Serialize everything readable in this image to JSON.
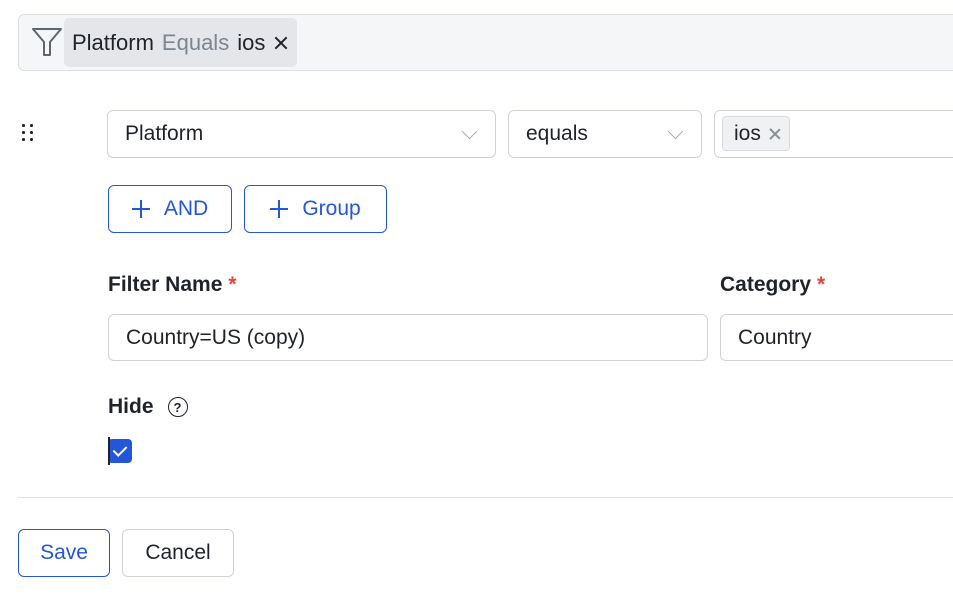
{
  "summary": {
    "field": "Platform",
    "operator": "Equals",
    "value": "ios",
    "icon": "funnel-icon"
  },
  "condition": {
    "field_select": "Platform",
    "operator_select": "equals",
    "value_tag": "ios"
  },
  "actions": {
    "and_label": "AND",
    "group_label": "Group"
  },
  "form": {
    "filter_name_label": "Filter Name",
    "filter_name_value": "Country=US (copy)",
    "category_label": "Category",
    "category_value": "Country",
    "required_mark": "*",
    "hide_label": "Hide",
    "help_glyph": "?",
    "hide_checked": true
  },
  "footer": {
    "save_label": "Save",
    "cancel_label": "Cancel"
  },
  "colors": {
    "accent": "#2356d8",
    "required": "#e0463b"
  }
}
